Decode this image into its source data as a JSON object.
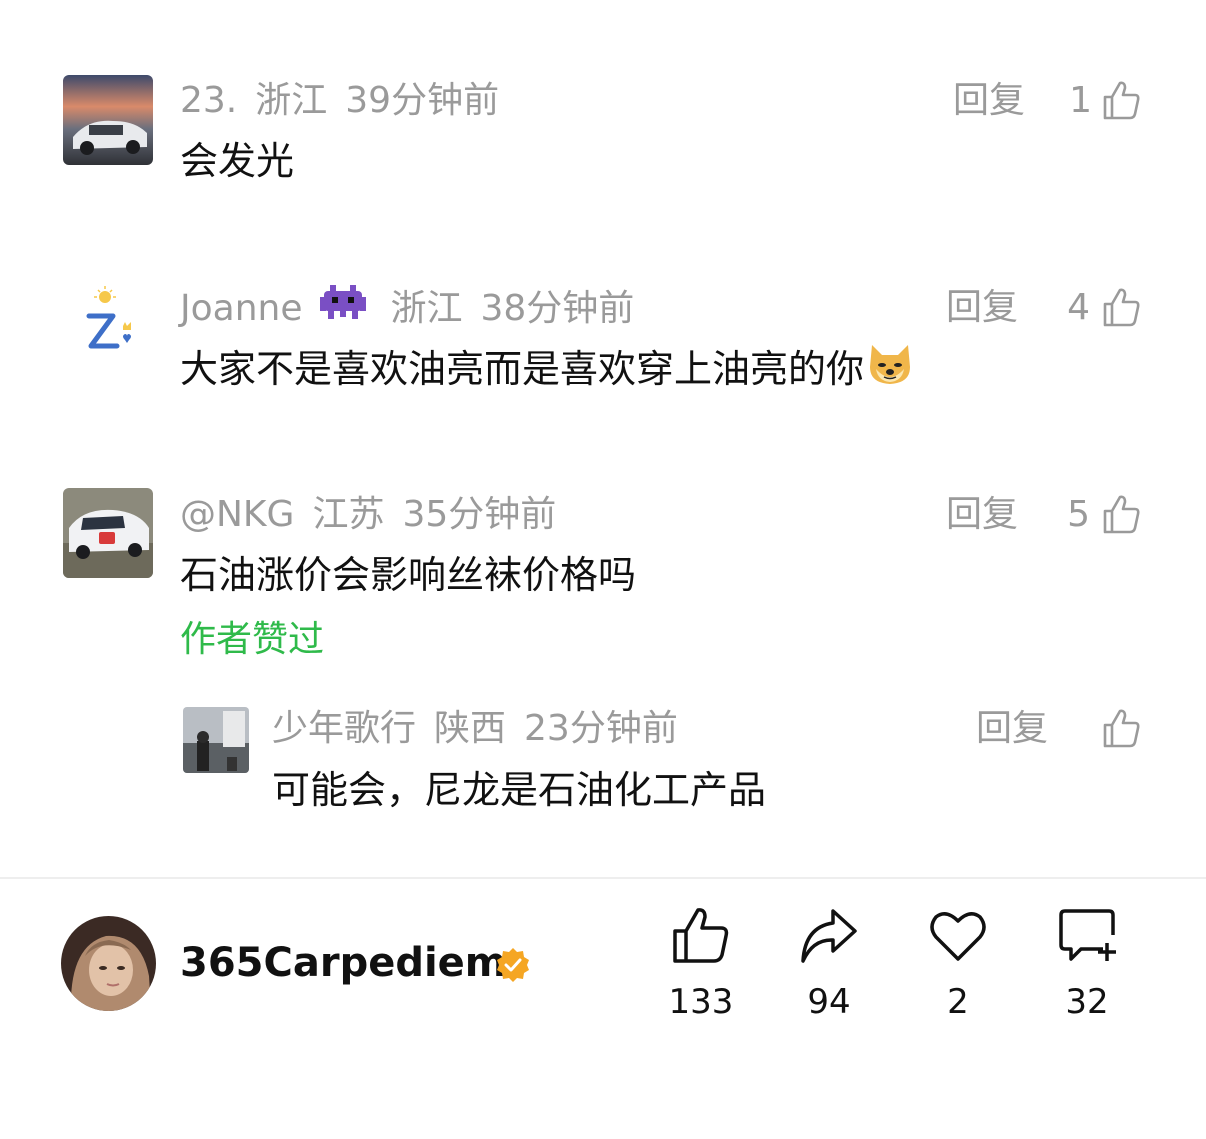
{
  "comments": [
    {
      "username": "23.",
      "location": "浙江",
      "time": "39分钟前",
      "text": "会发光",
      "reply_label": "回复",
      "likes": "1"
    },
    {
      "username": "Joanne",
      "location": "浙江",
      "time": "38分钟前",
      "text": "大家不是喜欢油亮而是喜欢穿上油亮的你",
      "reply_label": "回复",
      "likes": "4",
      "name_emoji": "alien-monster-emoji",
      "text_emoji": "doge-emoji"
    },
    {
      "username": "@NKG",
      "location": "江苏",
      "time": "35分钟前",
      "text": "石油涨价会影响丝袜价格吗",
      "reply_label": "回复",
      "likes": "5",
      "author_liked": "作者赞过",
      "sub_reply": {
        "username": "少年歌行",
        "location": "陕西",
        "time": "23分钟前",
        "text": "可能会，尼龙是石油化工产品",
        "reply_label": "回复"
      }
    }
  ],
  "footer": {
    "username": "365Carpediem",
    "verified_icon": "verified-badge-icon",
    "actions": [
      {
        "icon": "thumbs-up-icon",
        "count": "133"
      },
      {
        "icon": "share-icon",
        "count": "94"
      },
      {
        "icon": "heart-icon",
        "count": "2"
      },
      {
        "icon": "comment-add-icon",
        "count": "32"
      }
    ]
  },
  "colors": {
    "meta_gray": "#9a9a9a",
    "author_liked_green": "#2fba4a",
    "verified_orange": "#f5a623"
  }
}
